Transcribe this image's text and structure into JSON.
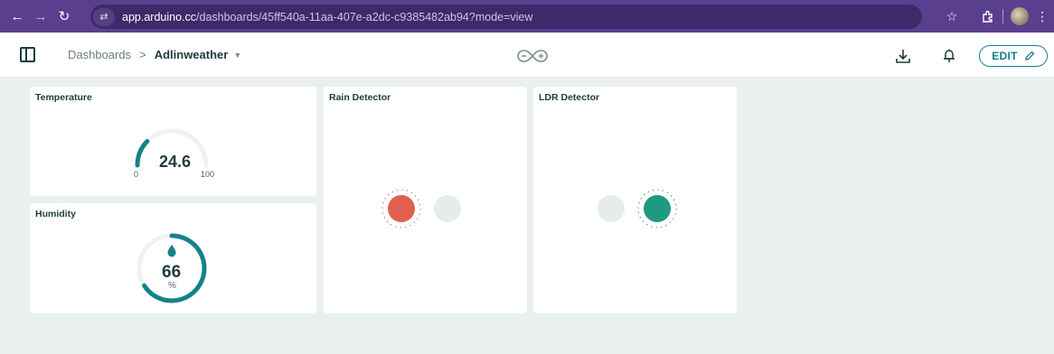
{
  "browser": {
    "url_host": "app.arduino.cc",
    "url_path": "/dashboards/45ff540a-11aa-407e-a2dc-c9385482ab94?mode=view"
  },
  "header": {
    "breadcrumb_root": "Dashboards",
    "breadcrumb_separator": ">",
    "dashboard_name": "Adlinweather",
    "edit_label": "EDIT"
  },
  "widgets": {
    "temperature": {
      "title": "Temperature",
      "value": "24.6",
      "min": "0",
      "max": "100",
      "numeric_value": 24.6,
      "numeric_min": 0,
      "numeric_max": 100
    },
    "humidity": {
      "title": "Humidity",
      "value": "66",
      "unit": "%",
      "numeric_value": 66
    },
    "rain": {
      "title": "Rain Detector",
      "leds": [
        {
          "state": "on",
          "color": "#e0604f"
        },
        {
          "state": "off",
          "color": "#e6ecec"
        }
      ]
    },
    "ldr": {
      "title": "LDR Detector",
      "leds": [
        {
          "state": "off",
          "color": "#e6ecec"
        },
        {
          "state": "on",
          "color": "#1f9a7e"
        }
      ]
    }
  },
  "colors": {
    "accent": "#16818a",
    "browser_bar": "#5a3f8e",
    "gauge_track": "#eef2f2"
  }
}
